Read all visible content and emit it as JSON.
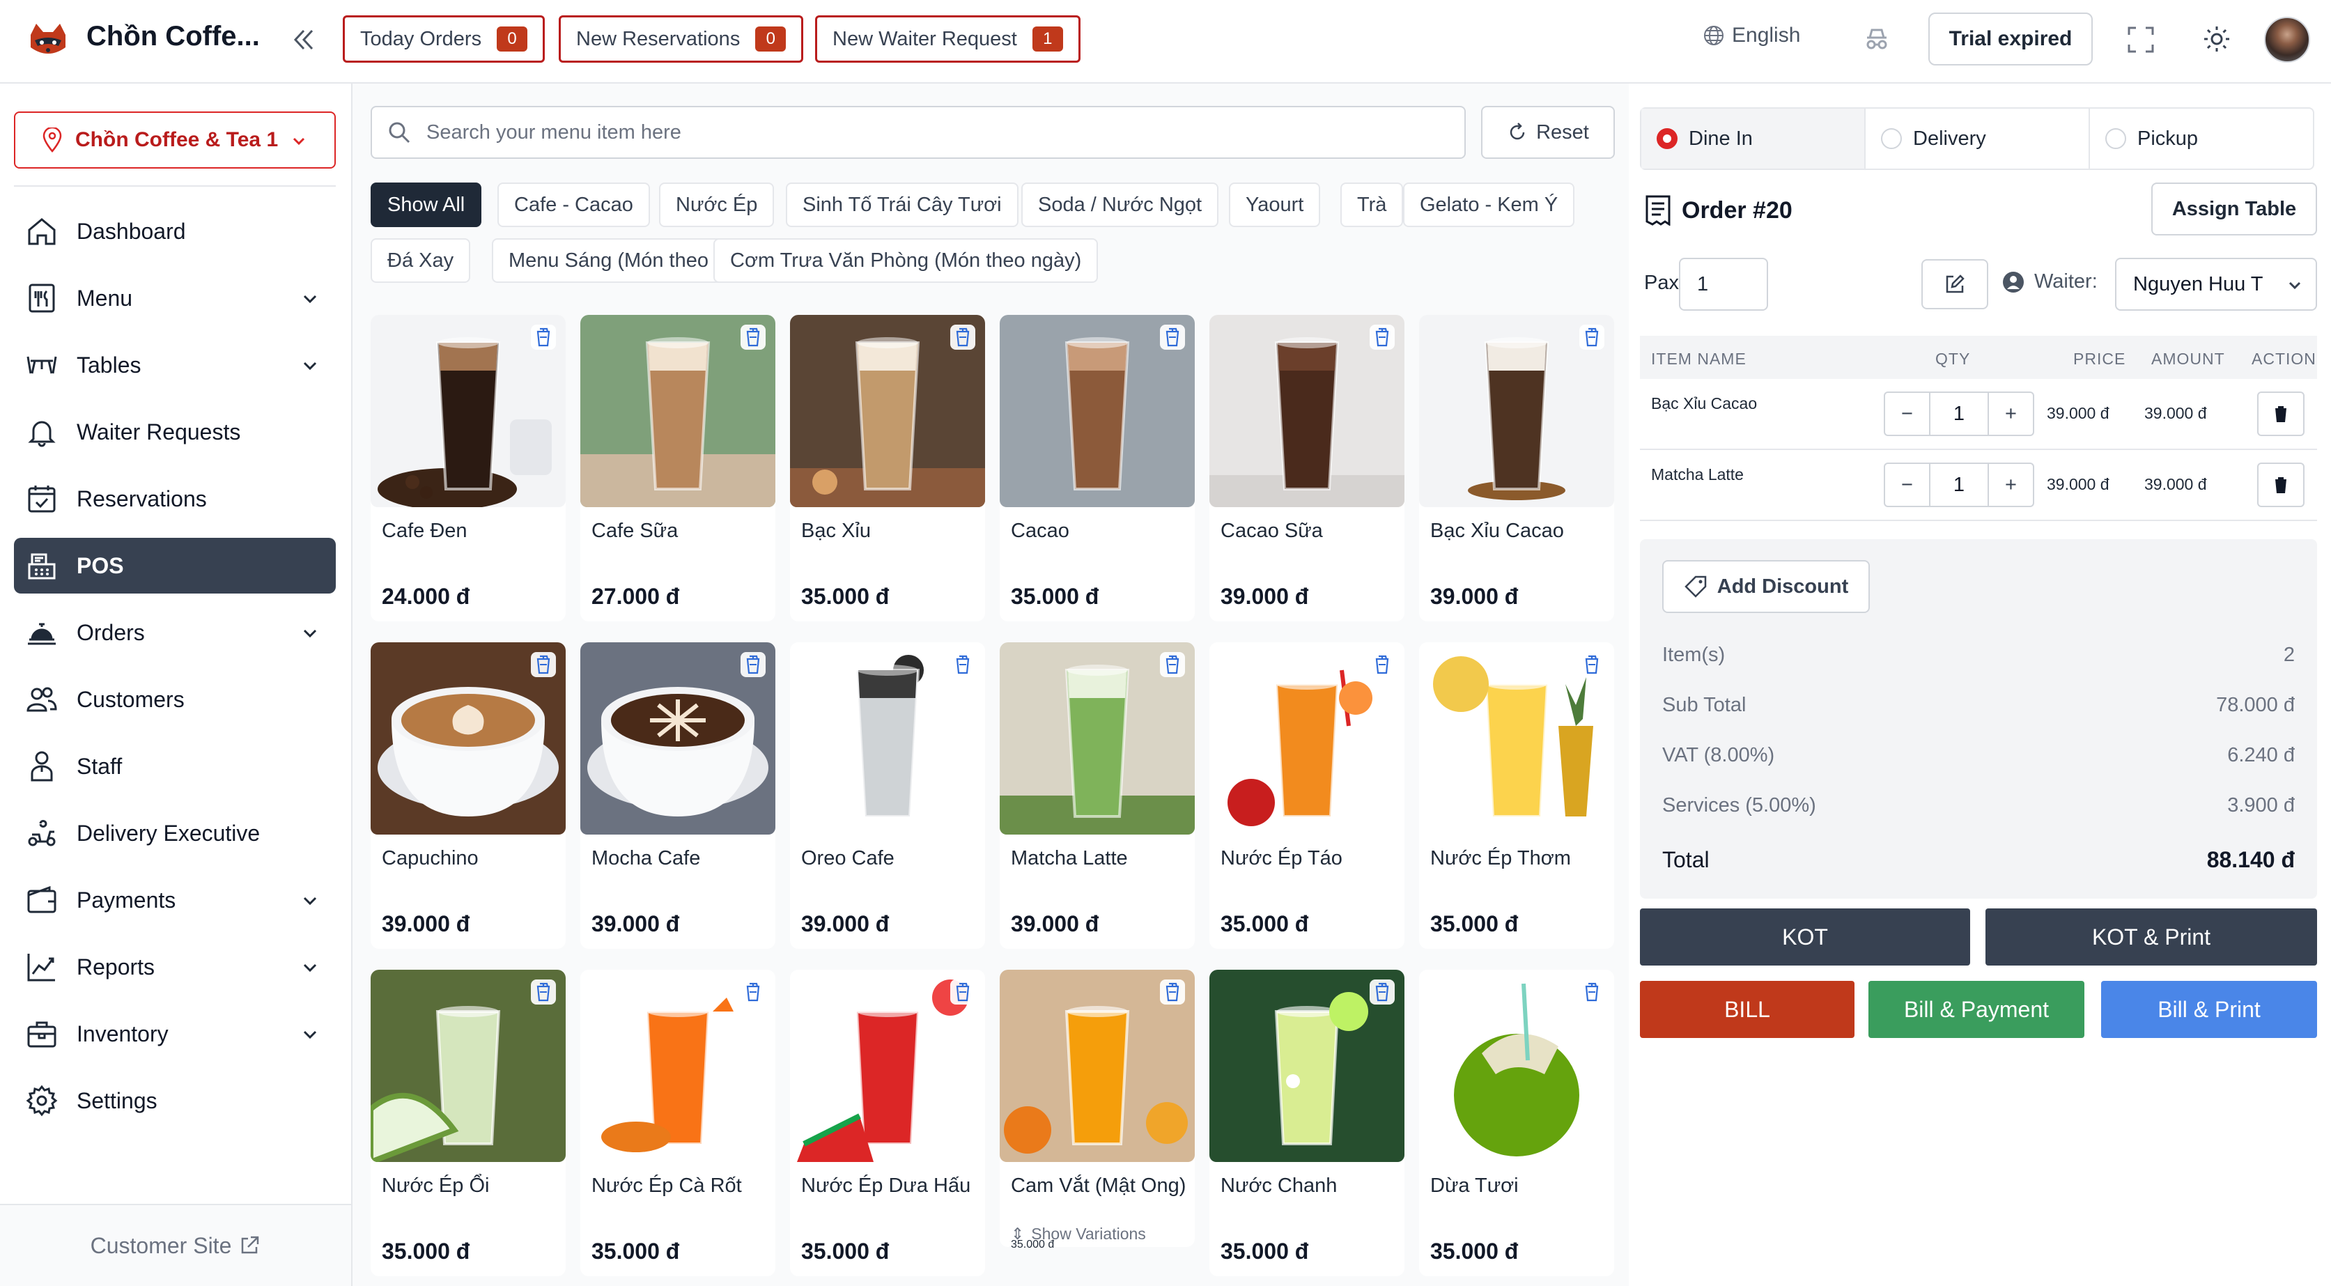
{
  "app": {
    "name": "Chồn Coffe..."
  },
  "topbar": {
    "today_orders": {
      "label": "Today Orders",
      "count": "0"
    },
    "new_reservations": {
      "label": "New Reservations",
      "count": "0"
    },
    "new_waiter_request": {
      "label": "New Waiter Request",
      "count": "1"
    },
    "language": "English",
    "trial": "Trial expired"
  },
  "sidebar": {
    "store": "Chồn Coffee & Tea 1",
    "items": [
      {
        "label": "Dashboard",
        "icon": "home-icon"
      },
      {
        "label": "Menu",
        "icon": "menu-icon"
      },
      {
        "label": "Tables",
        "icon": "table-icon"
      },
      {
        "label": "Waiter Requests",
        "icon": "bell-icon"
      },
      {
        "label": "Reservations",
        "icon": "calendar-check-icon"
      },
      {
        "label": "POS",
        "icon": "pos-icon"
      },
      {
        "label": "Orders",
        "icon": "cloche-icon"
      },
      {
        "label": "Customers",
        "icon": "users-icon"
      },
      {
        "label": "Staff",
        "icon": "staff-icon"
      },
      {
        "label": "Delivery Executive",
        "icon": "scooter-icon"
      },
      {
        "label": "Payments",
        "icon": "wallet-icon"
      },
      {
        "label": "Reports",
        "icon": "chart-line-icon"
      },
      {
        "label": "Inventory",
        "icon": "inventory-icon"
      },
      {
        "label": "Settings",
        "icon": "gear-icon"
      }
    ],
    "footer": "Customer Site"
  },
  "search": {
    "placeholder": "Search your menu item here",
    "reset": "Reset"
  },
  "categories": [
    "Show All",
    "Cafe - Cacao",
    "Nước Ép",
    "Sinh Tố Trái Cây Tươi",
    "Soda / Nước Ngọt",
    "Yaourt",
    "Trà",
    "Gelato - Kem Ý",
    "Đá Xay",
    "Menu Sáng (Món theo ngày)",
    "Cơm Trưa Văn Phòng (Món theo ngày)"
  ],
  "menu_items": [
    {
      "name": "Cafe Đen",
      "price": "24.000 đ"
    },
    {
      "name": "Cafe Sữa",
      "price": "27.000 đ"
    },
    {
      "name": "Bạc Xỉu",
      "price": "35.000 đ"
    },
    {
      "name": "Cacao",
      "price": "35.000 đ"
    },
    {
      "name": "Cacao Sữa",
      "price": "39.000 đ"
    },
    {
      "name": "Bạc Xỉu Cacao",
      "price": "39.000 đ"
    },
    {
      "name": "Capuchino",
      "price": "39.000 đ"
    },
    {
      "name": "Mocha Cafe",
      "price": "39.000 đ"
    },
    {
      "name": "Oreo Cafe",
      "price": "39.000 đ"
    },
    {
      "name": "Matcha Latte",
      "price": "39.000 đ"
    },
    {
      "name": "Nước Ép Táo",
      "price": "35.000 đ"
    },
    {
      "name": "Nước Ép Thơm",
      "price": "35.000 đ"
    },
    {
      "name": "Nước Ép Ổi",
      "price": "35.000 đ"
    },
    {
      "name": "Nước Ép Cà Rốt",
      "price": "35.000 đ"
    },
    {
      "name": "Nước Ép Dưa Hấu",
      "price": "35.000 đ"
    },
    {
      "name": "Cam Vắt (Mật Ong)",
      "price": "35.000 đ",
      "variations": "Show Variations"
    },
    {
      "name": "Nước Chanh",
      "price": "35.000 đ"
    },
    {
      "name": "Dừa Tươi",
      "price": "35.000 đ"
    }
  ],
  "order": {
    "types": [
      "Dine In",
      "Delivery",
      "Pickup"
    ],
    "selected_type": "Dine In",
    "title": "Order #20",
    "assign_table": "Assign Table",
    "pax_label": "Pax",
    "pax": "1",
    "waiter_label": "Waiter:",
    "waiter": "Nguyen Huu T",
    "columns": [
      "ITEM NAME",
      "QTY",
      "PRICE",
      "AMOUNT",
      "ACTION"
    ],
    "items": [
      {
        "name": "Bạc Xỉu Cacao",
        "qty": "1",
        "price": "39.000 đ",
        "amount": "39.000 đ"
      },
      {
        "name": "Matcha Latte",
        "qty": "1",
        "price": "39.000 đ",
        "amount": "39.000 đ"
      }
    ],
    "add_discount": "Add Discount",
    "summary": [
      {
        "label": "Item(s)",
        "value": "2"
      },
      {
        "label": "Sub Total",
        "value": "78.000 đ"
      },
      {
        "label": "VAT (8.00%)",
        "value": "6.240 đ"
      },
      {
        "label": "Services (5.00%)",
        "value": "3.900 đ"
      }
    ],
    "total_label": "Total",
    "total": "88.140 đ",
    "buttons": {
      "kot": "KOT",
      "kot_print": "KOT & Print",
      "bill": "BILL",
      "bill_payment": "Bill & Payment",
      "bill_print": "Bill & Print"
    }
  },
  "colors": {
    "accent": "#dc2626",
    "dark": "#374151",
    "bill": "#c0391b",
    "bill_payment": "#3a9d5d",
    "bill_print": "#4a86e8"
  }
}
